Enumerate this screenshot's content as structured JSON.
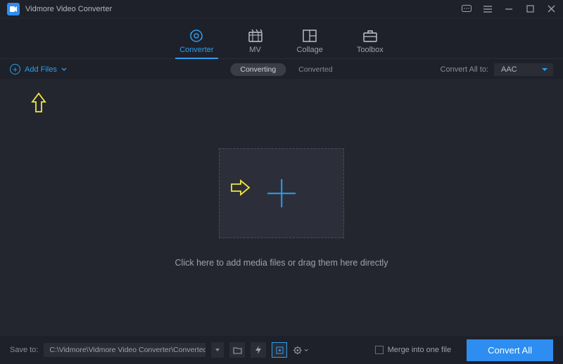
{
  "app": {
    "title": "Vidmore Video Converter"
  },
  "nav": {
    "items": [
      {
        "label": "Converter"
      },
      {
        "label": "MV"
      },
      {
        "label": "Collage"
      },
      {
        "label": "Toolbox"
      }
    ]
  },
  "subbar": {
    "add_files_label": "Add Files",
    "tab_converting": "Converting",
    "tab_converted": "Converted",
    "convert_all_to_label": "Convert All to:",
    "format_selected": "AAC"
  },
  "main": {
    "drop_text": "Click here to add media files or drag them here directly"
  },
  "footer": {
    "save_to_label": "Save to:",
    "save_path": "C:\\Vidmore\\Vidmore Video Converter\\Converted",
    "merge_label": "Merge into one file",
    "convert_button": "Convert All"
  }
}
